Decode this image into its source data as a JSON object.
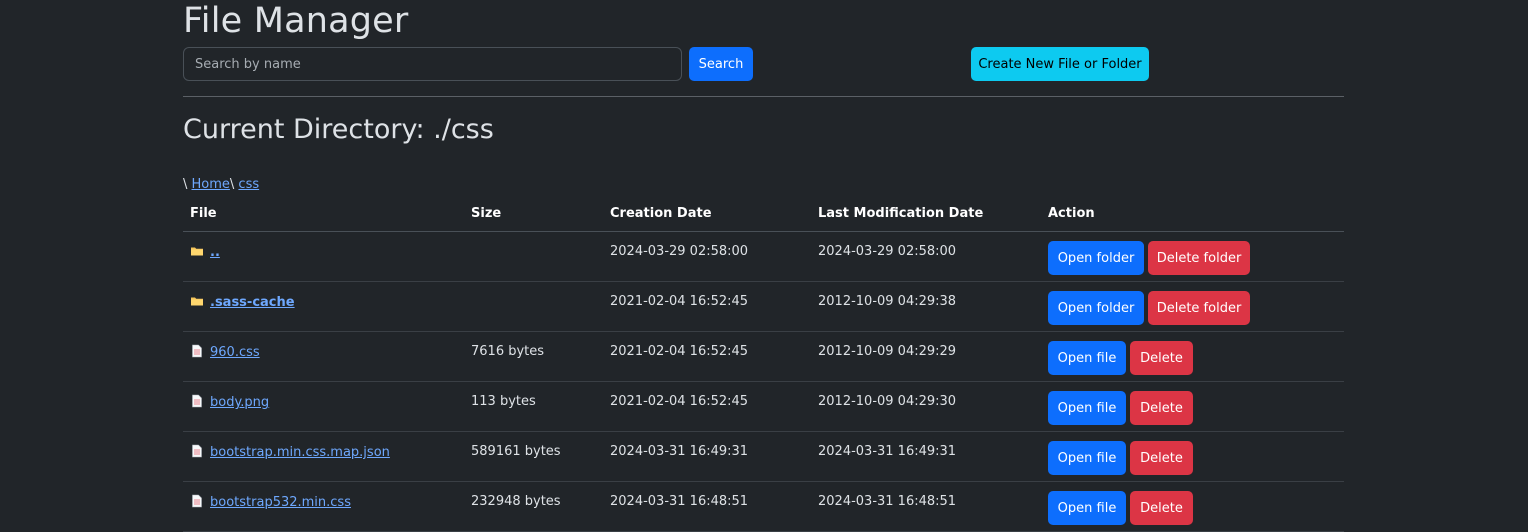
{
  "app": {
    "title": "File Manager"
  },
  "search": {
    "placeholder": "Search by name",
    "value": "",
    "button_label": "Search"
  },
  "toolbar": {
    "create_label": "Create New File or Folder"
  },
  "directory": {
    "heading": "Current Directory: ./css",
    "breadcrumb": {
      "sep1": "\\ ",
      "home": "Home",
      "sep2": "\\ ",
      "current": "css"
    }
  },
  "table": {
    "headers": {
      "file": "File",
      "size": "Size",
      "created": "Creation Date",
      "modified": "Last Modification Date",
      "action": "Action"
    },
    "rows": [
      {
        "name": "..",
        "type": "folder",
        "icon": "folder-icon",
        "size": "",
        "created": "2024-03-29 02:58:00",
        "modified": "2024-03-29 02:58:00",
        "open_label": "Open folder",
        "delete_label": "Delete folder"
      },
      {
        "name": ".sass-cache",
        "type": "folder",
        "icon": "folder-icon",
        "size": "",
        "created": "2021-02-04 16:52:45",
        "modified": "2012-10-09 04:29:38",
        "open_label": "Open folder",
        "delete_label": "Delete folder"
      },
      {
        "name": "960.css",
        "type": "file",
        "icon": "file-icon",
        "size": "7616 bytes",
        "created": "2021-02-04 16:52:45",
        "modified": "2012-10-09 04:29:29",
        "open_label": "Open file",
        "delete_label": "Delete"
      },
      {
        "name": "body.png",
        "type": "file",
        "icon": "file-icon",
        "size": "113 bytes",
        "created": "2021-02-04 16:52:45",
        "modified": "2012-10-09 04:29:30",
        "open_label": "Open file",
        "delete_label": "Delete"
      },
      {
        "name": "bootstrap.min.css.map.json",
        "type": "file",
        "icon": "file-icon",
        "size": "589161 bytes",
        "created": "2024-03-31 16:49:31",
        "modified": "2024-03-31 16:49:31",
        "open_label": "Open file",
        "delete_label": "Delete"
      },
      {
        "name": "bootstrap532.min.css",
        "type": "file",
        "icon": "file-icon",
        "size": "232948 bytes",
        "created": "2024-03-31 16:48:51",
        "modified": "2024-03-31 16:48:51",
        "open_label": "Open file",
        "delete_label": "Delete"
      }
    ]
  },
  "colors": {
    "background": "#212529",
    "text": "#dee2e6",
    "link": "#6ea8fe",
    "primary": "#0d6efd",
    "danger": "#dc3545",
    "info": "#0dcaf0"
  }
}
